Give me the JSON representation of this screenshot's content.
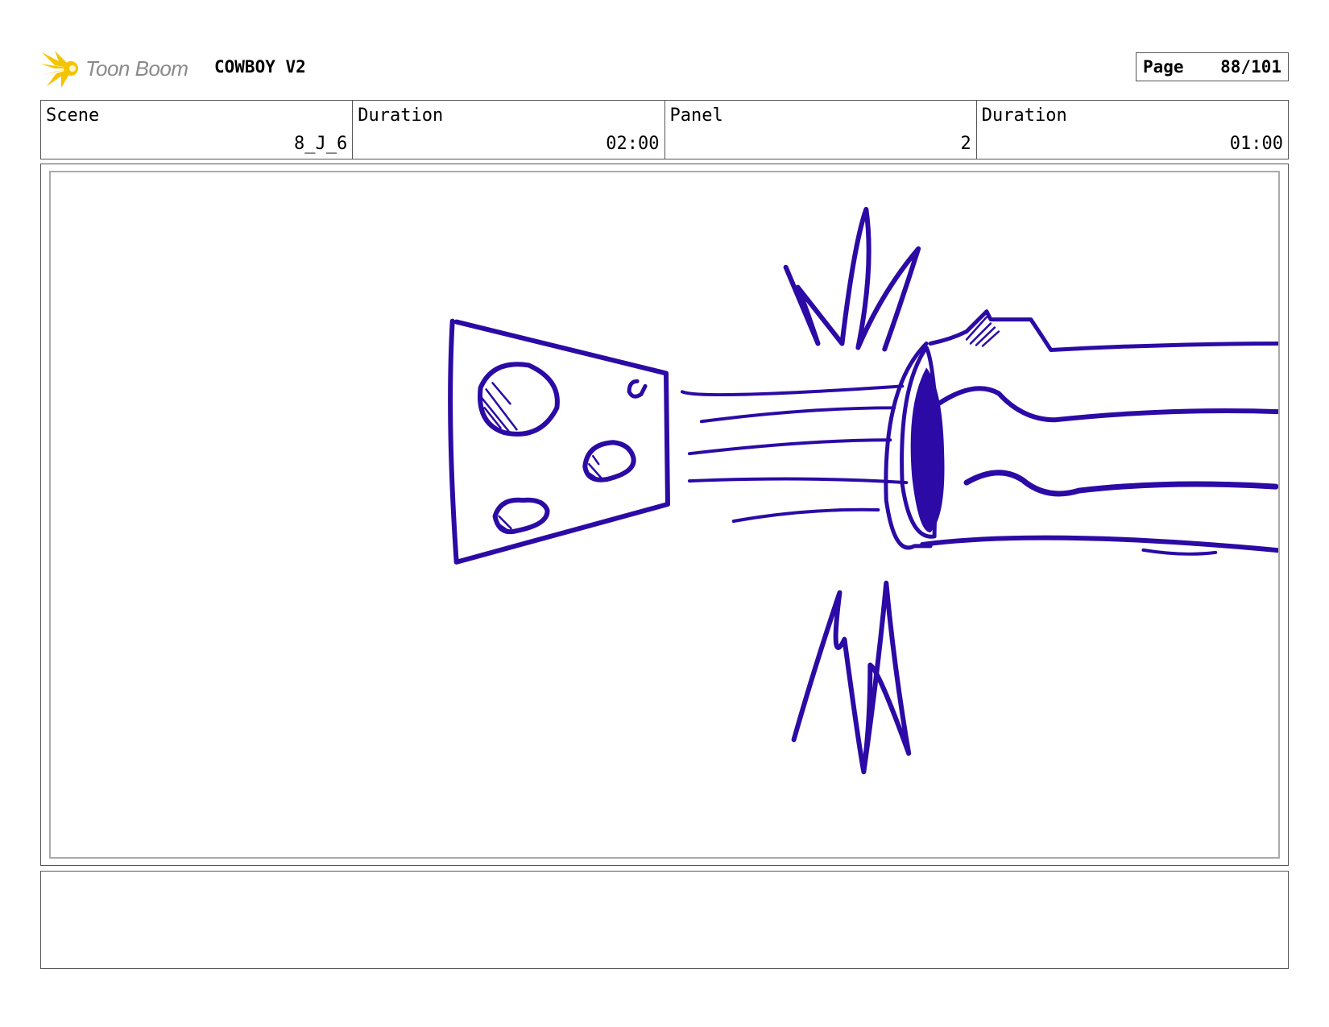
{
  "header": {
    "logo_text": "Toon Boom",
    "project_title": "COWBOY V2",
    "page_label": "Page",
    "page_number": "88/101"
  },
  "info": {
    "scene_label": "Scene",
    "scene_value": "8_J_6",
    "scene_duration_label": "Duration",
    "scene_duration_value": "02:00",
    "panel_label": "Panel",
    "panel_value": "2",
    "panel_duration_label": "Duration",
    "panel_duration_value": "01:00"
  },
  "drawing": {
    "ink_color": "#2b0aa5",
    "logo_color": "#f5c400"
  },
  "notes": {
    "text": ""
  }
}
